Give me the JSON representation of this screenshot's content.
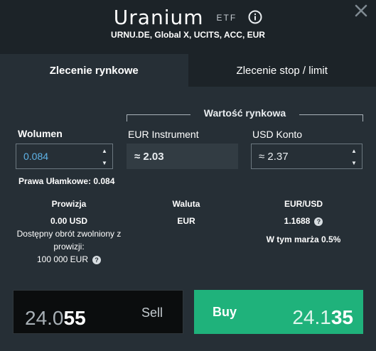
{
  "header": {
    "title": "Uranium",
    "type_badge": "ETF",
    "subtitle": "URNU.DE, Global X, UCITS, ACC, EUR"
  },
  "tabs": [
    {
      "label": "Zlecenie rynkowe",
      "active": true
    },
    {
      "label": "Zlecenie stop / limit",
      "active": false
    }
  ],
  "market_value": {
    "label": "Wartość rynkowa"
  },
  "volume": {
    "label": "Wolumen",
    "value": "0.084",
    "fractional_rights": "Prawa Ułamkowe: 0.084"
  },
  "instrument_value": {
    "label": "EUR Instrument",
    "value": "≈ 2.03"
  },
  "account_value": {
    "label": "USD Konto",
    "value": "≈ 2.37"
  },
  "commission": {
    "label": "Prowizja",
    "value": "0.00 USD",
    "note_line1": "Dostępny obrót zwolniony z",
    "note_line2": "prowizji:",
    "note_amount": "100 000 EUR"
  },
  "currency": {
    "label": "Waluta",
    "value": "EUR"
  },
  "fx": {
    "label": "EUR/USD",
    "value": "1.1688",
    "margin_note": "W tym marża 0.5%"
  },
  "sell": {
    "label": "Sell",
    "price_main": "24.0",
    "price_pips": "55"
  },
  "buy": {
    "label": "Buy",
    "price_main": "24.1",
    "price_pips": "35"
  },
  "colors": {
    "buy_green": "#1fb27b",
    "sell_black": "#0b0d0e",
    "volume_blue": "#5fb4e8"
  }
}
